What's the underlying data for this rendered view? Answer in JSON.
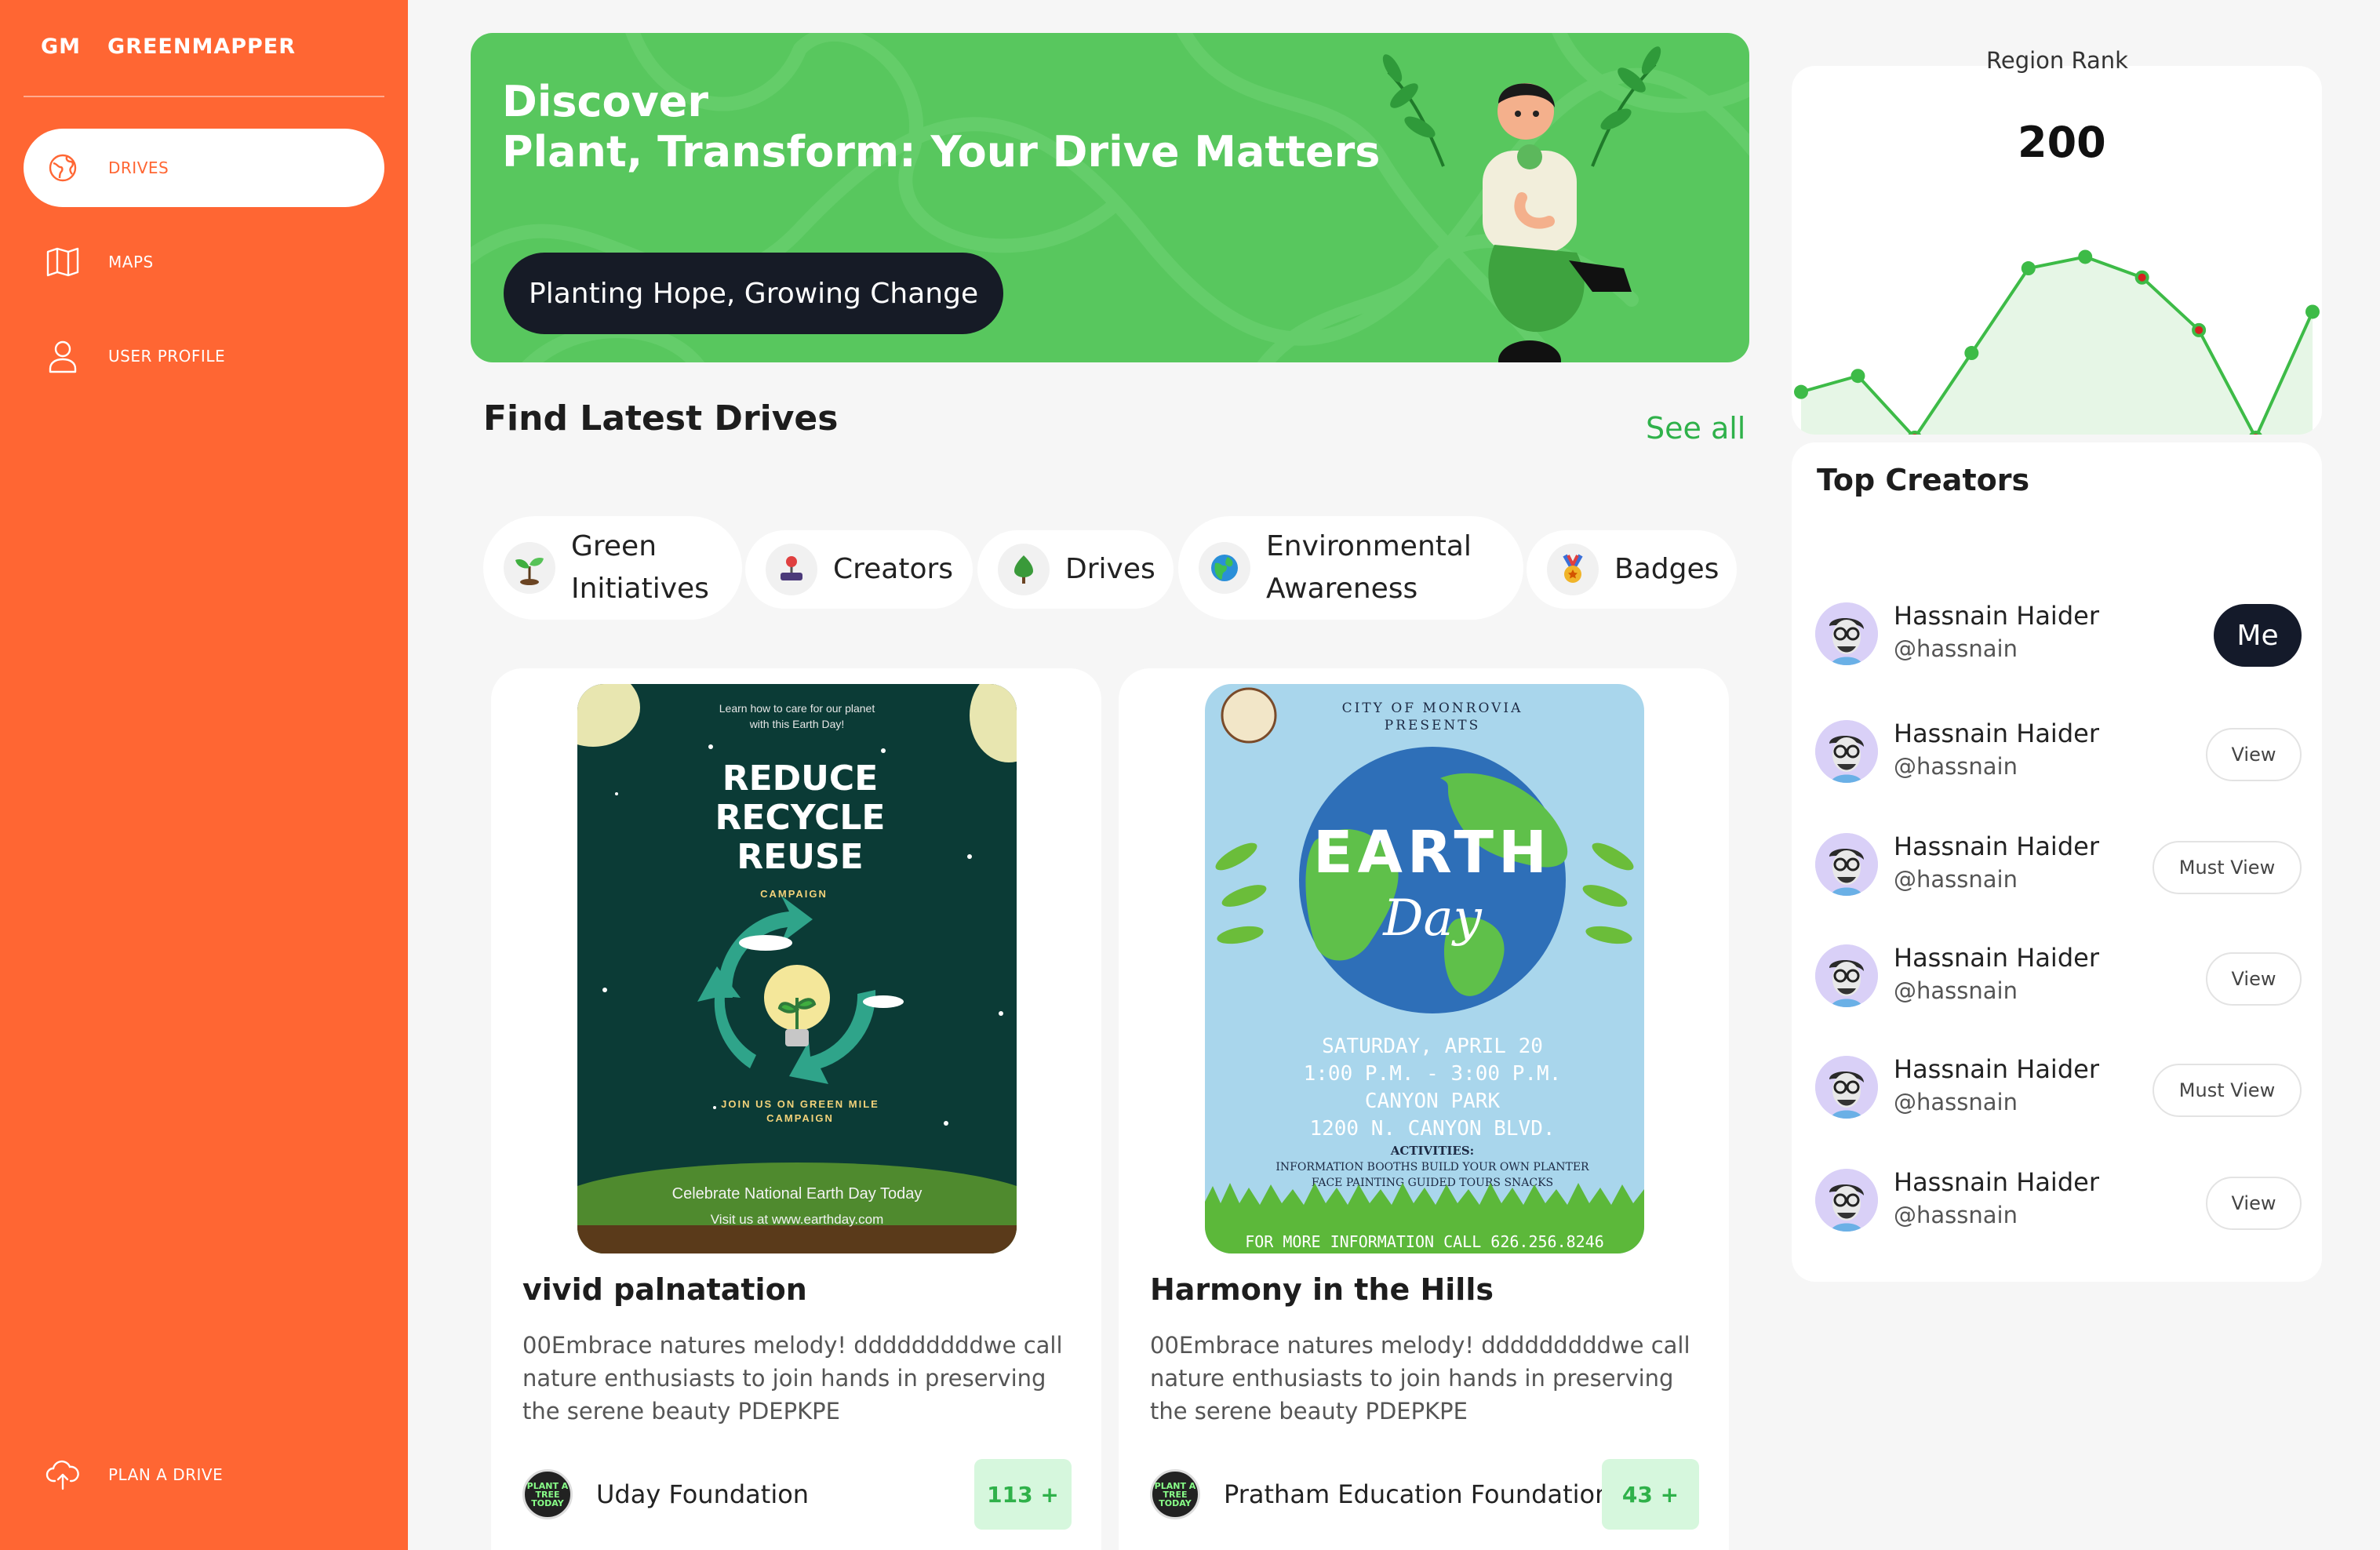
{
  "sidebar": {
    "brand_short": "GM",
    "brand_name": "GREENMAPPER",
    "items": [
      {
        "label": "DRIVES",
        "icon": "globe-icon",
        "active": true
      },
      {
        "label": "MAPS",
        "icon": "map-icon",
        "active": false
      },
      {
        "label": "USER PROFILE",
        "icon": "user-icon",
        "active": false
      }
    ],
    "bottom_item": {
      "label": "PLAN A DRIVE",
      "icon": "cloud-upload-icon"
    }
  },
  "banner": {
    "title_line1": "Discover",
    "title_line2": "Plant, Transform: Your Drive Matters",
    "button_label": "Planting Hope, Growing Change"
  },
  "drives_section": {
    "title": "Find Latest Drives",
    "see_all_label": "See all"
  },
  "categories": [
    {
      "line1": "Green",
      "line2": "Initiatives",
      "icon": "sprout-icon"
    },
    {
      "line1": "Creators",
      "line2": "",
      "icon": "joystick-icon"
    },
    {
      "line1": "Drives",
      "line2": "",
      "icon": "tree-icon"
    },
    {
      "line1": "Environmental",
      "line2": "Awareness",
      "icon": "earth-icon"
    },
    {
      "line1": "Badges",
      "line2": "",
      "icon": "medal-icon"
    }
  ],
  "drives": [
    {
      "title": "vivid palnatation",
      "description": "00Embrace natures melody! dddddddddwe call nature enthusiasts to join hands in preserving the serene beauty PDEPKPE",
      "org_name": "Uday Foundation",
      "org_logo_text": "PLANT A TREE TODAY",
      "count_label": "113 +",
      "poster": {
        "top_text_1": "Learn how to care for our planet",
        "top_text_2": "with this Earth Day!",
        "headline_1": "REDUCE",
        "headline_2": "RECYCLE",
        "headline_3": "REUSE",
        "sub": "CAMPAIGN",
        "join_1": "JOIN US ON GREEN MILE",
        "join_2": "CAMPAIGN",
        "footer_1": "Celebrate National Earth Day Today",
        "footer_2": "Visit us at www.earthday.com"
      }
    },
    {
      "title": "Harmony in the Hills",
      "description": "00Embrace natures melody! dddddddddwe call nature enthusiasts to join hands in preserving the serene beauty PDEPKPE",
      "org_name": "Pratham Education Foundation",
      "org_logo_text": "PLANT A TREE TODAY",
      "count_label": "43 +",
      "poster": {
        "city": "CITY OF MONROVIA",
        "presents": "PRESENTS",
        "earth": "EARTH",
        "day": "Day",
        "date": "SATURDAY, APRIL 20",
        "time": "1:00 P.M. - 3:00 P.M.",
        "park": "CANYON PARK",
        "address": "1200 N. CANYON BLVD.",
        "activities_title": "ACTIVITIES:",
        "activities_1": "INFORMATION BOOTHS BUILD YOUR OWN PLANTER",
        "activities_2": "FACE PAINTING GUIDED TOURS  SNACKS",
        "footer": "FOR MORE INFORMATION CALL 626.256.8246"
      }
    }
  ],
  "region_rank": {
    "label": "Region Rank",
    "value": "200",
    "chart_data": {
      "type": "line",
      "series": [
        {
          "values": [
            0.2,
            0.27,
            0.0,
            0.37,
            0.74,
            0.79,
            0.7,
            0.47,
            0.0,
            0.55
          ]
        }
      ],
      "highlighted_low_points": [
        2,
        6,
        7,
        8
      ],
      "colors": {
        "line": "#3dbb47",
        "fill": "#e6f6e6",
        "marker": "#3dbb47",
        "marker_highlight": "#d62020"
      }
    }
  },
  "top_creators": {
    "title": "Top Creators",
    "list": [
      {
        "name": "Hassnain Haider",
        "handle": "@hassnain",
        "button": "Me",
        "type": "me"
      },
      {
        "name": "Hassnain Haider",
        "handle": "@hassnain",
        "button": "View",
        "type": "view"
      },
      {
        "name": "Hassnain Haider",
        "handle": "@hassnain",
        "button": "Must View",
        "type": "must"
      },
      {
        "name": "Hassnain Haider",
        "handle": "@hassnain",
        "button": "View",
        "type": "view"
      },
      {
        "name": "Hassnain Haider",
        "handle": "@hassnain",
        "button": "Must View",
        "type": "must"
      },
      {
        "name": "Hassnain Haider",
        "handle": "@hassnain",
        "button": "View",
        "type": "view"
      }
    ]
  },
  "colors": {
    "sidebar": "#ff6633",
    "banner": "#58c75e",
    "accent_green": "#2fb14a",
    "dark_button": "#161b26"
  }
}
